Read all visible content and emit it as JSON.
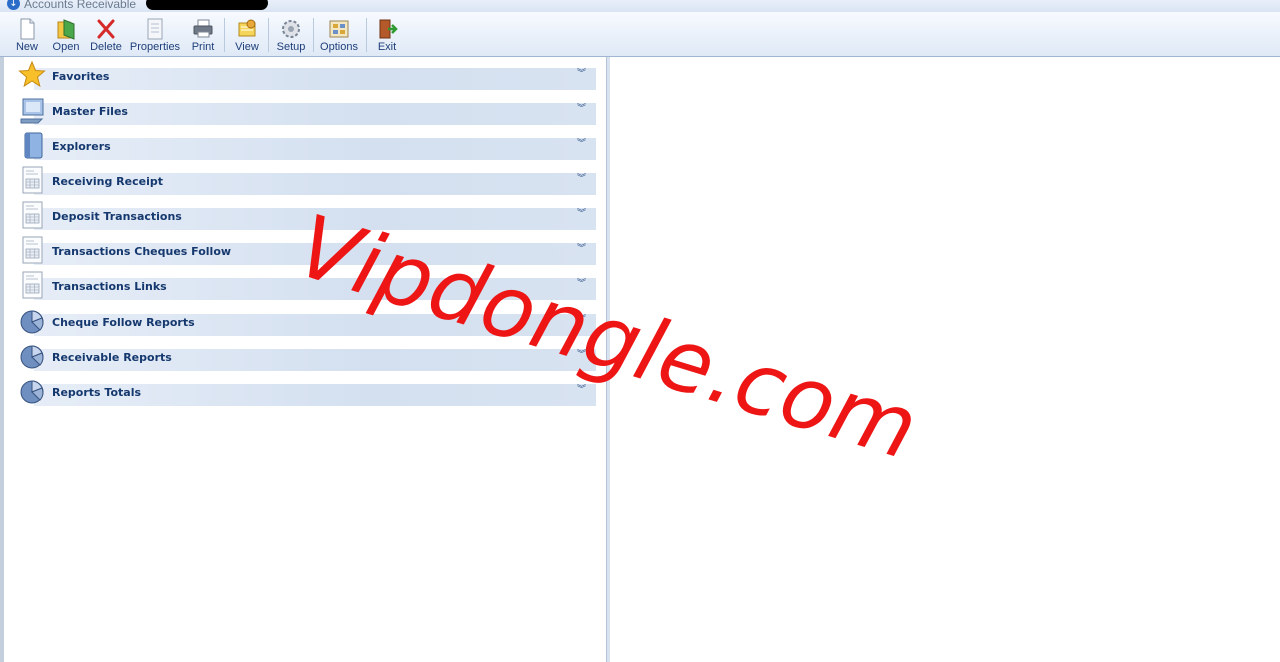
{
  "window": {
    "title": "Accounts Receivable"
  },
  "toolbar": {
    "buttons": [
      {
        "label": "New",
        "icon": "new-document-icon"
      },
      {
        "label": "Open",
        "icon": "open-folder-icon"
      },
      {
        "label": "Delete",
        "icon": "delete-x-icon"
      },
      {
        "label": "Properties",
        "icon": "properties-icon"
      },
      {
        "label": "Print",
        "icon": "printer-icon"
      },
      {
        "label": "View",
        "icon": "view-icon"
      },
      {
        "label": "Setup",
        "icon": "gear-icon"
      },
      {
        "label": "Options",
        "icon": "options-icon"
      },
      {
        "label": "Exit",
        "icon": "exit-door-icon"
      }
    ]
  },
  "sidebar": {
    "items": [
      {
        "label": "Favorites",
        "icon": "star-icon"
      },
      {
        "label": "Master Files",
        "icon": "master-files-icon"
      },
      {
        "label": "Explorers",
        "icon": "explorer-book-icon"
      },
      {
        "label": "Receiving Receipt",
        "icon": "form-document-icon"
      },
      {
        "label": "Deposit Transactions",
        "icon": "form-document-icon"
      },
      {
        "label": "Transactions Cheques Follow",
        "icon": "form-document-icon"
      },
      {
        "label": "Transactions Links",
        "icon": "form-document-icon"
      },
      {
        "label": "Cheque Follow Reports",
        "icon": "pie-report-icon"
      },
      {
        "label": "Receivable Reports",
        "icon": "pie-report-icon"
      },
      {
        "label": "Reports Totals",
        "icon": "pie-report-icon"
      }
    ]
  },
  "watermark": {
    "text": "Vipdongle.com"
  },
  "colors": {
    "accent": "#15386e",
    "watermark": "#ee1515",
    "toolbar_text": "#1f3f7a"
  }
}
